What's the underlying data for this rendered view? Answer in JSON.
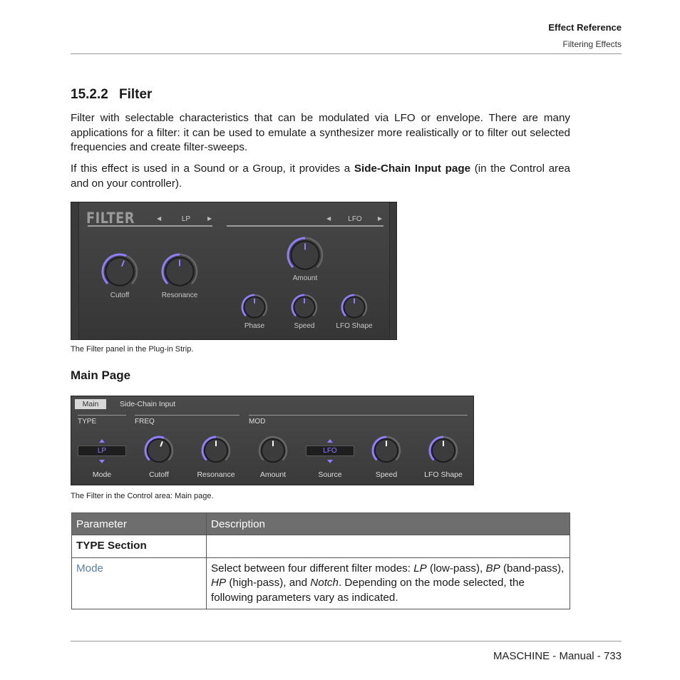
{
  "header": {
    "chapter": "Effect Reference",
    "section": "Filtering Effects"
  },
  "heading": {
    "number": "15.2.2",
    "title": "Filter"
  },
  "intro": {
    "p1": "Filter with selectable characteristics that can be modulated via LFO or envelope. There are many applications for a filter: it can be used to emulate a synthesizer more realistically or to filter out selected frequencies and create filter-sweeps.",
    "p2_before": "If this effect is used in a Sound or a Group, it provides a ",
    "p2_bold": "Side-Chain Input page",
    "p2_after": " (in the Control area and on your controller)."
  },
  "plugin_strip": {
    "title": "FILTER",
    "left_selector": "LP",
    "right_selector": "LFO",
    "knobs": {
      "cutoff": {
        "label": "Cutoff",
        "value": 0.58
      },
      "resonance": {
        "label": "Resonance",
        "value": 0.5
      },
      "amount": {
        "label": "Amount",
        "value": 0.5
      },
      "phase": {
        "label": "Phase",
        "value": 0.5
      },
      "speed": {
        "label": "Speed",
        "value": 0.5
      },
      "lfo_shape": {
        "label": "LFO Shape",
        "value": 0.5
      }
    },
    "caption": "The Filter panel in the Plug-in Strip."
  },
  "main_page": {
    "heading": "Main Page"
  },
  "control_area": {
    "tabs": [
      "Main",
      "Side-Chain Input"
    ],
    "sections": [
      "TYPE",
      "FREQ",
      "MOD"
    ],
    "mode_value": "LP",
    "source_value": "LFO",
    "labels": {
      "mode": "Mode",
      "cutoff": "Cutoff",
      "resonance": "Resonance",
      "amount": "Amount",
      "source": "Source",
      "speed": "Speed",
      "lfo_shape": "LFO Shape"
    },
    "knob_values": {
      "cutoff": 0.58,
      "resonance": 0.5,
      "amount": 0.5,
      "speed": 0.5,
      "lfo_shape": 0.5
    },
    "caption": "The Filter in the Control area: Main page."
  },
  "table": {
    "headers": [
      "Parameter",
      "Description"
    ],
    "section_row": "TYPE Section",
    "mode_param": "Mode",
    "mode_desc": {
      "t1": "Select between four different filter modes: ",
      "i1": "LP",
      "t2": " (low-pass), ",
      "i2": "BP",
      "t3": " (band-pass), ",
      "i3": "HP",
      "t4": " (high-pass), and ",
      "i4": "Notch",
      "t5": ". Depending on the mode selected, the following parameters vary as indicated."
    }
  },
  "footer": {
    "text": "MASCHINE - Manual - 733"
  },
  "colors": {
    "accent": "#8f7dff",
    "link": "#5d7fa8",
    "table_header": "#6e6e6e"
  }
}
